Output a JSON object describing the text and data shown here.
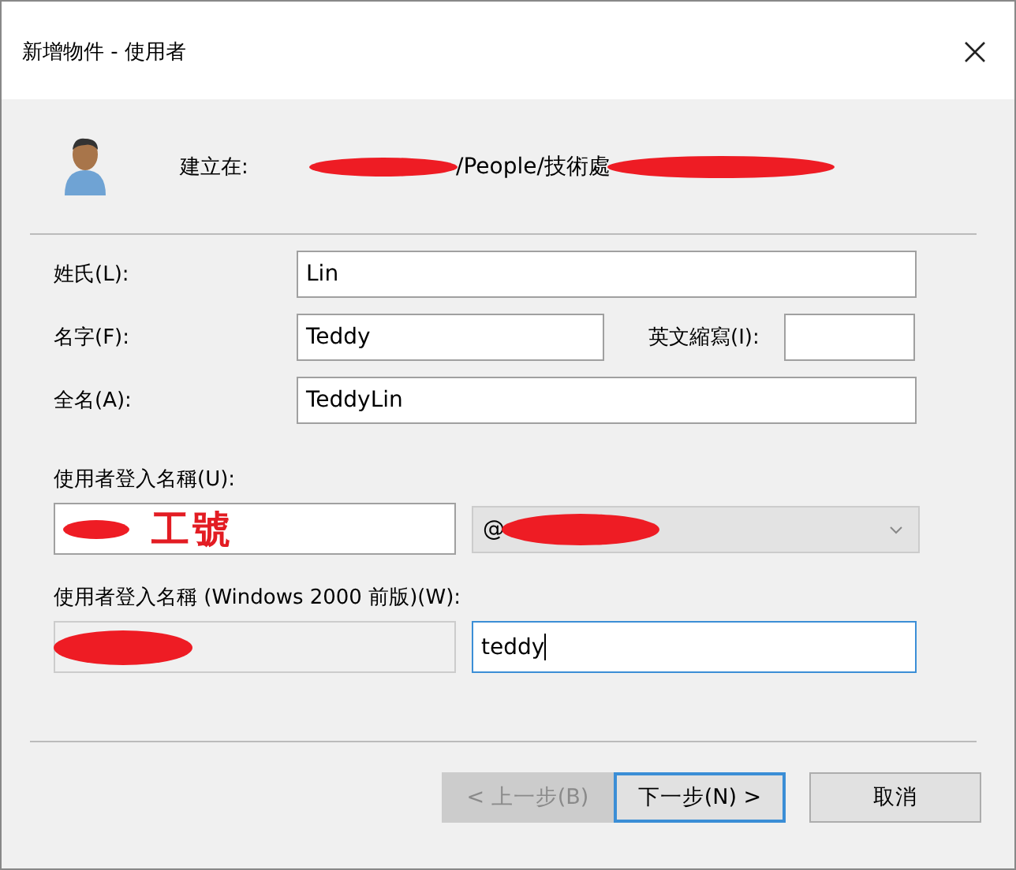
{
  "window": {
    "title": "新增物件 - 使用者"
  },
  "header": {
    "label": "建立在:",
    "path": "/People/技術處"
  },
  "name_fields": [
    {
      "label": "姓氏(L):",
      "value": "Lin"
    },
    {
      "label": "名字(F):",
      "value": "Teddy",
      "initials_label": "英文縮寫(I):"
    },
    {
      "label": "全名(A):",
      "value": "TeddyLin"
    }
  ],
  "logon": {
    "label": "使用者登入名稱(U):",
    "value": "工號",
    "domain": "@"
  },
  "legacy_logon": {
    "label": "使用者登入名稱 (Windows 2000 前版)(W):",
    "domain_disabled": true,
    "value": "teddy",
    "focused": true
  },
  "buttons": [
    {
      "label": "< 上一步(B)",
      "disabled": true,
      "default": false
    },
    {
      "label": "下一步(N) >",
      "disabled": false,
      "default": true
    },
    {
      "label": "取消",
      "disabled": false,
      "default": false
    }
  ]
}
